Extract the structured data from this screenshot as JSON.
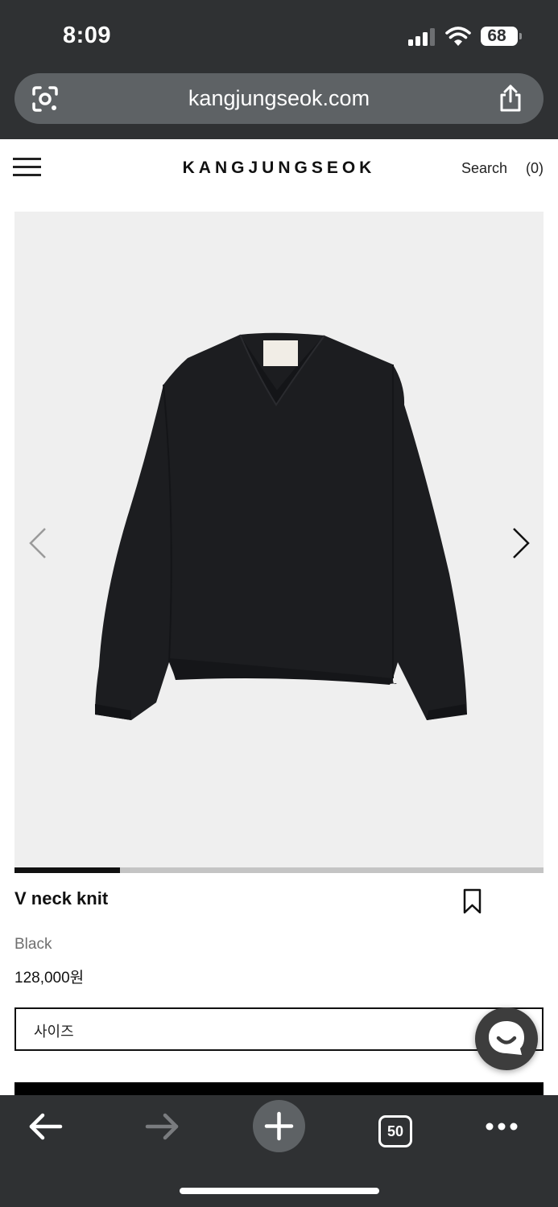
{
  "status_bar": {
    "time": "8:09",
    "battery": "68",
    "icons": [
      "signal-icon",
      "wifi-icon",
      "battery-icon"
    ]
  },
  "browser": {
    "url": "kangjungseok.com",
    "icons": [
      "lens-icon",
      "share-icon"
    ]
  },
  "header": {
    "brand": "KANGJUNGSEOK",
    "search": "Search",
    "cart": "(0)"
  },
  "gallery": {
    "product_color_hex": "#1c1d20",
    "background_hex": "#efefef",
    "progress": 0.2
  },
  "product": {
    "name": "V neck knit",
    "color": "Black",
    "price": "128,000원",
    "size_label": "사이즈"
  },
  "toolbar": {
    "tabs_count": "50",
    "icons": [
      "back-icon",
      "forward-icon",
      "plus-icon",
      "tabs-icon",
      "more-icon"
    ]
  },
  "colors": {
    "chrome_bg": "#2f3133",
    "url_bar_bg": "#5e6265",
    "text": "#111111",
    "muted": "#6f6f6f"
  }
}
